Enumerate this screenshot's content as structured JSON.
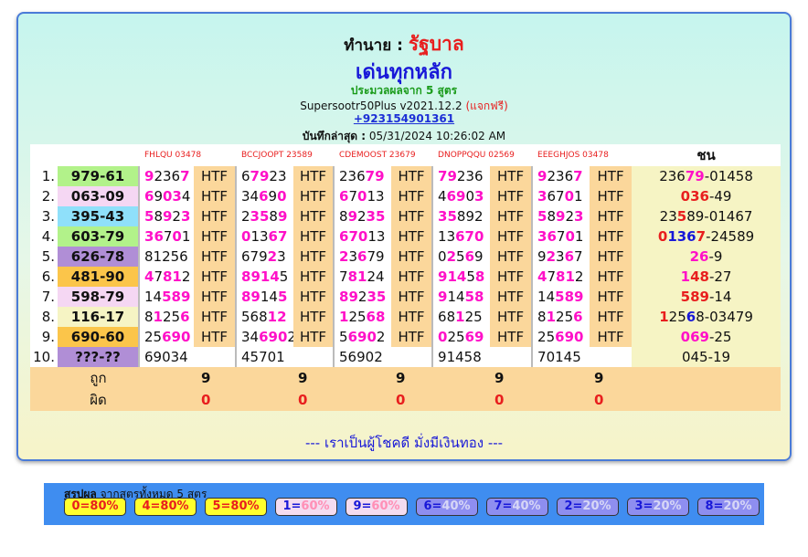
{
  "header": {
    "predict_label": "ทำนาย :",
    "lottery_name": "รัฐบาล",
    "subtitle": "เด่นทุกหลัก",
    "processed_from_prefix": "ประมวลผลจาก",
    "formula_count": "5",
    "formula_suffix": "สูตร",
    "version": "Supersootr50Plus v2021.12.2",
    "free_note": "(แจกฟรี)",
    "phone": "+923154901361",
    "last_saved_label": "บันทึกล่าสุด :",
    "last_saved_value": "05/31/2024 10:26:02 AM"
  },
  "columns": [
    {
      "name": "FHLQU 03478"
    },
    {
      "name": "BCCJOOPT 23589"
    },
    {
      "name": "CDEMOOST 23679"
    },
    {
      "name": "DNOPPQQU 02569"
    },
    {
      "name": "EEEGHJOS 03478"
    }
  ],
  "chon_header": "ชน",
  "htf_label": "HTF",
  "rows": [
    {
      "idx": "1.",
      "label": "979-61",
      "label_color": "#b2f28a",
      "cells": [
        [
          [
            "9",
            1
          ],
          [
            "236",
            0
          ],
          [
            "7",
            1
          ]
        ],
        [
          [
            "6",
            0
          ],
          [
            "79",
            1
          ],
          [
            "23",
            0
          ]
        ],
        [
          [
            "236",
            0
          ],
          [
            "79",
            1
          ]
        ],
        [
          [
            "79",
            1
          ],
          [
            "236",
            0
          ]
        ],
        [
          [
            "9",
            1
          ],
          [
            "236",
            0
          ],
          [
            "7",
            1
          ]
        ]
      ],
      "chon": [
        [
          "236",
          0
        ],
        [
          "79",
          2
        ],
        [
          "-01458",
          0
        ]
      ]
    },
    {
      "idx": "2.",
      "label": "063-09",
      "label_color": "#f5d7f3",
      "cells": [
        [
          [
            "6",
            1
          ],
          [
            "9",
            0
          ],
          [
            "03",
            1
          ],
          [
            "4",
            0
          ]
        ],
        [
          [
            "34",
            0
          ],
          [
            "6",
            1
          ],
          [
            "9",
            0
          ],
          [
            "0",
            1
          ]
        ],
        [
          [
            "6",
            1
          ],
          [
            "7",
            0
          ],
          [
            "0",
            1
          ],
          [
            "13",
            0
          ]
        ],
        [
          [
            "4",
            0
          ],
          [
            "69",
            1
          ],
          [
            "0",
            0
          ],
          [
            "3",
            1
          ]
        ],
        [
          [
            "3",
            1
          ],
          [
            "67",
            0
          ],
          [
            "0",
            1
          ],
          [
            "1",
            0
          ]
        ]
      ],
      "chon": [
        [
          "036",
          3
        ],
        [
          "-49",
          0
        ]
      ]
    },
    {
      "idx": "3.",
      "label": "395-43",
      "label_color": "#8fe0fa",
      "cells": [
        [
          [
            "5",
            1
          ],
          [
            "8",
            0
          ],
          [
            "9",
            1
          ],
          [
            "2",
            0
          ],
          [
            "3",
            1
          ]
        ],
        [
          [
            "2",
            0
          ],
          [
            "35",
            1
          ],
          [
            "8",
            0
          ],
          [
            "9",
            1
          ]
        ],
        [
          [
            "8",
            0
          ],
          [
            "9",
            1
          ],
          [
            "2",
            0
          ],
          [
            "35",
            1
          ]
        ],
        [
          [
            "35",
            1
          ],
          [
            "89",
            0
          ],
          [
            "2",
            0
          ]
        ],
        [
          [
            "5",
            1
          ],
          [
            "8",
            0
          ],
          [
            "9",
            1
          ],
          [
            "2",
            0
          ],
          [
            "3",
            1
          ]
        ]
      ],
      "chon": [
        [
          "23",
          0
        ],
        [
          "5",
          3
        ],
        [
          "89-01467",
          0
        ]
      ]
    },
    {
      "idx": "4.",
      "label": "603-79",
      "label_color": "#b2f28a",
      "cells": [
        [
          [
            "3",
            1
          ],
          [
            "6",
            1
          ],
          [
            "7",
            0
          ],
          [
            "0",
            1
          ],
          [
            "1",
            0
          ]
        ],
        [
          [
            "0",
            1
          ],
          [
            "13",
            0
          ],
          [
            "6",
            1
          ],
          [
            "7",
            1
          ]
        ],
        [
          [
            "67",
            1
          ],
          [
            "0",
            1
          ],
          [
            "13",
            0
          ]
        ],
        [
          [
            "13",
            0
          ],
          [
            "67",
            1
          ],
          [
            "0",
            1
          ]
        ],
        [
          [
            "3",
            1
          ],
          [
            "6",
            1
          ],
          [
            "7",
            0
          ],
          [
            "0",
            1
          ],
          [
            "1",
            0
          ]
        ]
      ],
      "chon": [
        [
          "0",
          3
        ],
        [
          "136",
          1
        ],
        [
          "7",
          3
        ],
        [
          "-24589",
          0
        ]
      ]
    },
    {
      "idx": "5.",
      "label": "626-78",
      "label_color": "#b08ed6",
      "cells": [
        [
          [
            "8",
            0
          ],
          [
            "12",
            0
          ],
          [
            "56",
            0
          ]
        ],
        [
          [
            "67",
            0
          ],
          [
            "9",
            0
          ],
          [
            "2",
            1
          ],
          [
            "3",
            0
          ]
        ],
        [
          [
            "2",
            1
          ],
          [
            "3",
            0
          ],
          [
            "6",
            1
          ],
          [
            "79",
            0
          ]
        ],
        [
          [
            "0",
            0
          ],
          [
            "2",
            1
          ],
          [
            "5",
            0
          ],
          [
            "6",
            1
          ],
          [
            "9",
            0
          ]
        ],
        [
          [
            "9",
            0
          ],
          [
            "2",
            1
          ],
          [
            "3",
            0
          ],
          [
            "6",
            1
          ],
          [
            "7",
            0
          ]
        ]
      ],
      "chon": [
        [
          "26",
          2
        ],
        [
          "-9",
          0
        ]
      ]
    },
    {
      "idx": "6.",
      "label": "481-90",
      "label_color": "#fbc54a",
      "cells": [
        [
          [
            "4",
            1
          ],
          [
            "7",
            0
          ],
          [
            "8",
            1
          ],
          [
            "1",
            1
          ],
          [
            "2",
            0
          ]
        ],
        [
          [
            "8",
            1
          ],
          [
            "9",
            1
          ],
          [
            "1",
            1
          ],
          [
            "4",
            1
          ],
          [
            "5",
            0
          ]
        ],
        [
          [
            "7",
            0
          ],
          [
            "8",
            1
          ],
          [
            "1",
            1
          ],
          [
            "24",
            0
          ]
        ],
        [
          [
            "9",
            1
          ],
          [
            "1",
            1
          ],
          [
            "4",
            1
          ],
          [
            "5",
            0
          ],
          [
            "8",
            1
          ]
        ],
        [
          [
            "4",
            1
          ],
          [
            "7",
            0
          ],
          [
            "8",
            1
          ],
          [
            "1",
            1
          ],
          [
            "2",
            0
          ]
        ]
      ],
      "chon": [
        [
          "1",
          2
        ],
        [
          "48",
          3
        ],
        [
          "-27",
          0
        ]
      ]
    },
    {
      "idx": "7.",
      "label": "598-79",
      "label_color": "#f5d7f3",
      "cells": [
        [
          [
            "14",
            0
          ],
          [
            "589",
            1
          ]
        ],
        [
          [
            "89",
            1
          ],
          [
            "1",
            0
          ],
          [
            "4",
            0
          ],
          [
            "5",
            1
          ]
        ],
        [
          [
            "89",
            1
          ],
          [
            "2",
            0
          ],
          [
            "35",
            1
          ]
        ],
        [
          [
            "9",
            1
          ],
          [
            "14",
            0
          ],
          [
            "58",
            1
          ]
        ],
        [
          [
            "14",
            0
          ],
          [
            "589",
            1
          ]
        ]
      ],
      "chon": [
        [
          "589",
          3
        ],
        [
          "-14",
          0
        ]
      ]
    },
    {
      "idx": "8.",
      "label": "116-17",
      "label_color": "#f6f4c4",
      "cells": [
        [
          [
            "8",
            0
          ],
          [
            "1",
            1
          ],
          [
            "25",
            0
          ],
          [
            "6",
            1
          ]
        ],
        [
          [
            "568",
            0
          ],
          [
            "12",
            1
          ]
        ],
        [
          [
            "1",
            1
          ],
          [
            "25",
            0
          ],
          [
            "68",
            1
          ]
        ],
        [
          [
            "68",
            0
          ],
          [
            "1",
            1
          ],
          [
            "25",
            0
          ]
        ],
        [
          [
            "8",
            0
          ],
          [
            "1",
            1
          ],
          [
            "25",
            0
          ],
          [
            "6",
            1
          ]
        ]
      ],
      "chon": [
        [
          "1",
          3
        ],
        [
          "25",
          0
        ],
        [
          "6",
          1
        ],
        [
          "8-03479",
          0
        ]
      ]
    },
    {
      "idx": "9.",
      "label": "690-60",
      "label_color": "#fbc54a",
      "cells": [
        [
          [
            "25",
            0
          ],
          [
            "69",
            1
          ],
          [
            "0",
            1
          ]
        ],
        [
          [
            "34",
            0
          ],
          [
            "69",
            1
          ],
          [
            "0",
            1
          ],
          [
            "2",
            0
          ]
        ],
        [
          [
            "5",
            0
          ],
          [
            "69",
            1
          ],
          [
            "0",
            1
          ],
          [
            "2",
            0
          ]
        ],
        [
          [
            "0",
            1
          ],
          [
            "25",
            0
          ],
          [
            "69",
            1
          ]
        ],
        [
          [
            "25",
            0
          ],
          [
            "69",
            1
          ],
          [
            "0",
            1
          ]
        ]
      ],
      "chon": [
        [
          "069",
          2
        ],
        [
          "-25",
          0
        ]
      ]
    },
    {
      "idx": "10.",
      "label": "???-??",
      "label_color": "#b08ed6",
      "cells": [
        [
          [
            "69034",
            0
          ]
        ],
        [
          [
            "45701",
            0
          ]
        ],
        [
          [
            "56902",
            0
          ]
        ],
        [
          [
            "91458",
            0
          ]
        ],
        [
          [
            "70145",
            0
          ]
        ]
      ],
      "chon": [
        [
          "045-19",
          0
        ]
      ]
    }
  ],
  "footer": {
    "correct_label": "ถูก",
    "wrong_label": "ผิด",
    "correct_values": [
      "9",
      "9",
      "9",
      "9",
      "9"
    ],
    "wrong_values": [
      "0",
      "0",
      "0",
      "0",
      "0"
    ]
  },
  "slogan": "--- เราเป็นผู้โชคดี มั่งมีเงินทอง ---",
  "summary": {
    "title_bold": "สรุปผล",
    "title_rest": "จากสูตรทั้งหมด 5 สูตร",
    "chips": [
      {
        "key": "0",
        "pct": "80%",
        "tone": "yellow"
      },
      {
        "key": "4",
        "pct": "80%",
        "tone": "yellow"
      },
      {
        "key": "5",
        "pct": "80%",
        "tone": "yellow"
      },
      {
        "key": "1",
        "pct": "60%",
        "tone": "pink"
      },
      {
        "key": "9",
        "pct": "60%",
        "tone": "pink"
      },
      {
        "key": "6",
        "pct": "40%",
        "tone": "blue"
      },
      {
        "key": "7",
        "pct": "40%",
        "tone": "blue"
      },
      {
        "key": "2",
        "pct": "20%",
        "tone": "blue"
      },
      {
        "key": "3",
        "pct": "20%",
        "tone": "blue"
      },
      {
        "key": "8",
        "pct": "20%",
        "tone": "blue"
      }
    ]
  }
}
